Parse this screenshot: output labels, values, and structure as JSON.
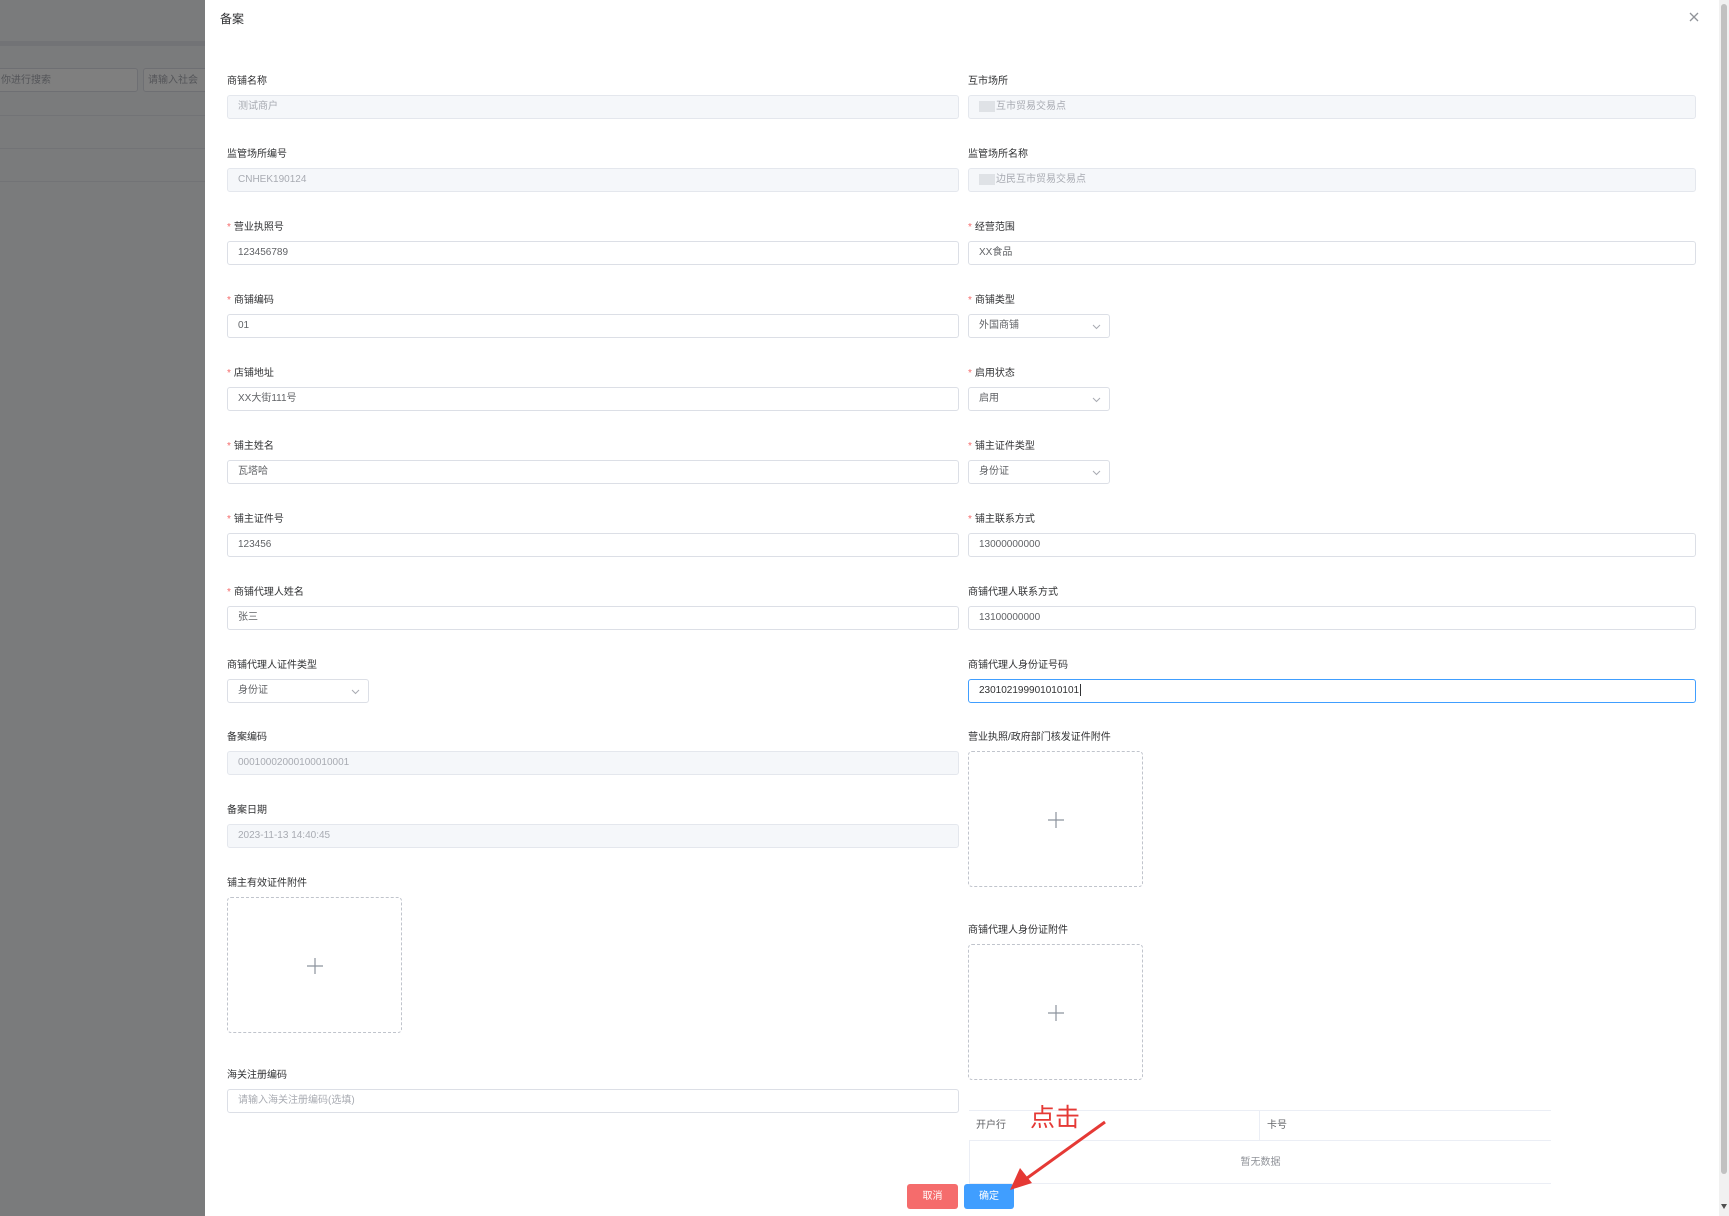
{
  "background": {
    "search_placeholder_1": "你进行搜索",
    "search_placeholder_2": "请输入社会"
  },
  "dialog": {
    "title": "备案",
    "close_icon": "close-icon"
  },
  "form": {
    "shop_name": {
      "label": "商铺名称",
      "value": "测试商户",
      "disabled": true
    },
    "market": {
      "label": "互市场所",
      "value": "互市贸易交易点",
      "disabled": true
    },
    "site_code": {
      "label": "监管场所编号",
      "value": "CNHEK190124",
      "disabled": true
    },
    "site_name": {
      "label": "监管场所名称",
      "value": "边民互市贸易交易点",
      "disabled": true
    },
    "license_no": {
      "label": "营业执照号",
      "value": "123456789",
      "required": true
    },
    "business_scope": {
      "label": "经营范围",
      "value": "XX食品",
      "required": true
    },
    "shop_code": {
      "label": "商铺编码",
      "value": "01",
      "required": true
    },
    "shop_type": {
      "label": "商铺类型",
      "value": "外国商铺",
      "required": true
    },
    "address": {
      "label": "店铺地址",
      "value": "XX大街111号",
      "required": true
    },
    "status": {
      "label": "启用状态",
      "value": "启用",
      "required": true
    },
    "owner_name": {
      "label": "铺主姓名",
      "value": "瓦塔哈",
      "required": true
    },
    "owner_id_type": {
      "label": "铺主证件类型",
      "value": "身份证",
      "required": true
    },
    "owner_id_no": {
      "label": "铺主证件号",
      "value": "123456",
      "required": true
    },
    "owner_phone": {
      "label": "铺主联系方式",
      "value": "13000000000",
      "required": true
    },
    "agent_name": {
      "label": "商铺代理人姓名",
      "value": "张三",
      "required": true
    },
    "agent_phone": {
      "label": "商铺代理人联系方式",
      "value": "13100000000"
    },
    "agent_id_type": {
      "label": "商铺代理人证件类型",
      "value": "身份证"
    },
    "agent_id_no": {
      "label": "商铺代理人身份证号码",
      "value": "230102199901010101"
    },
    "record_code": {
      "label": "备案编码",
      "value": "00010002000100010001",
      "disabled": true
    },
    "license_attach": {
      "label": "营业执照/政府部门核发证件附件"
    },
    "record_date": {
      "label": "备案日期",
      "value": "2023-11-13 14:40:45",
      "disabled": true
    },
    "owner_attach": {
      "label": "铺主有效证件附件"
    },
    "agent_attach": {
      "label": "商铺代理人身份证附件"
    },
    "customs_code": {
      "label": "海关注册编码",
      "placeholder": "请输入海关注册编码(选填)"
    }
  },
  "bank_table": {
    "columns": [
      "开户行",
      "卡号"
    ],
    "empty_text": "暂无数据"
  },
  "buttons": {
    "cancel": "取消",
    "confirm": "确定"
  },
  "annotation": {
    "text": "点击",
    "color": "#e53935"
  },
  "colors": {
    "primary": "#409eff",
    "danger": "#f56c6c",
    "required": "#f56c6c"
  }
}
